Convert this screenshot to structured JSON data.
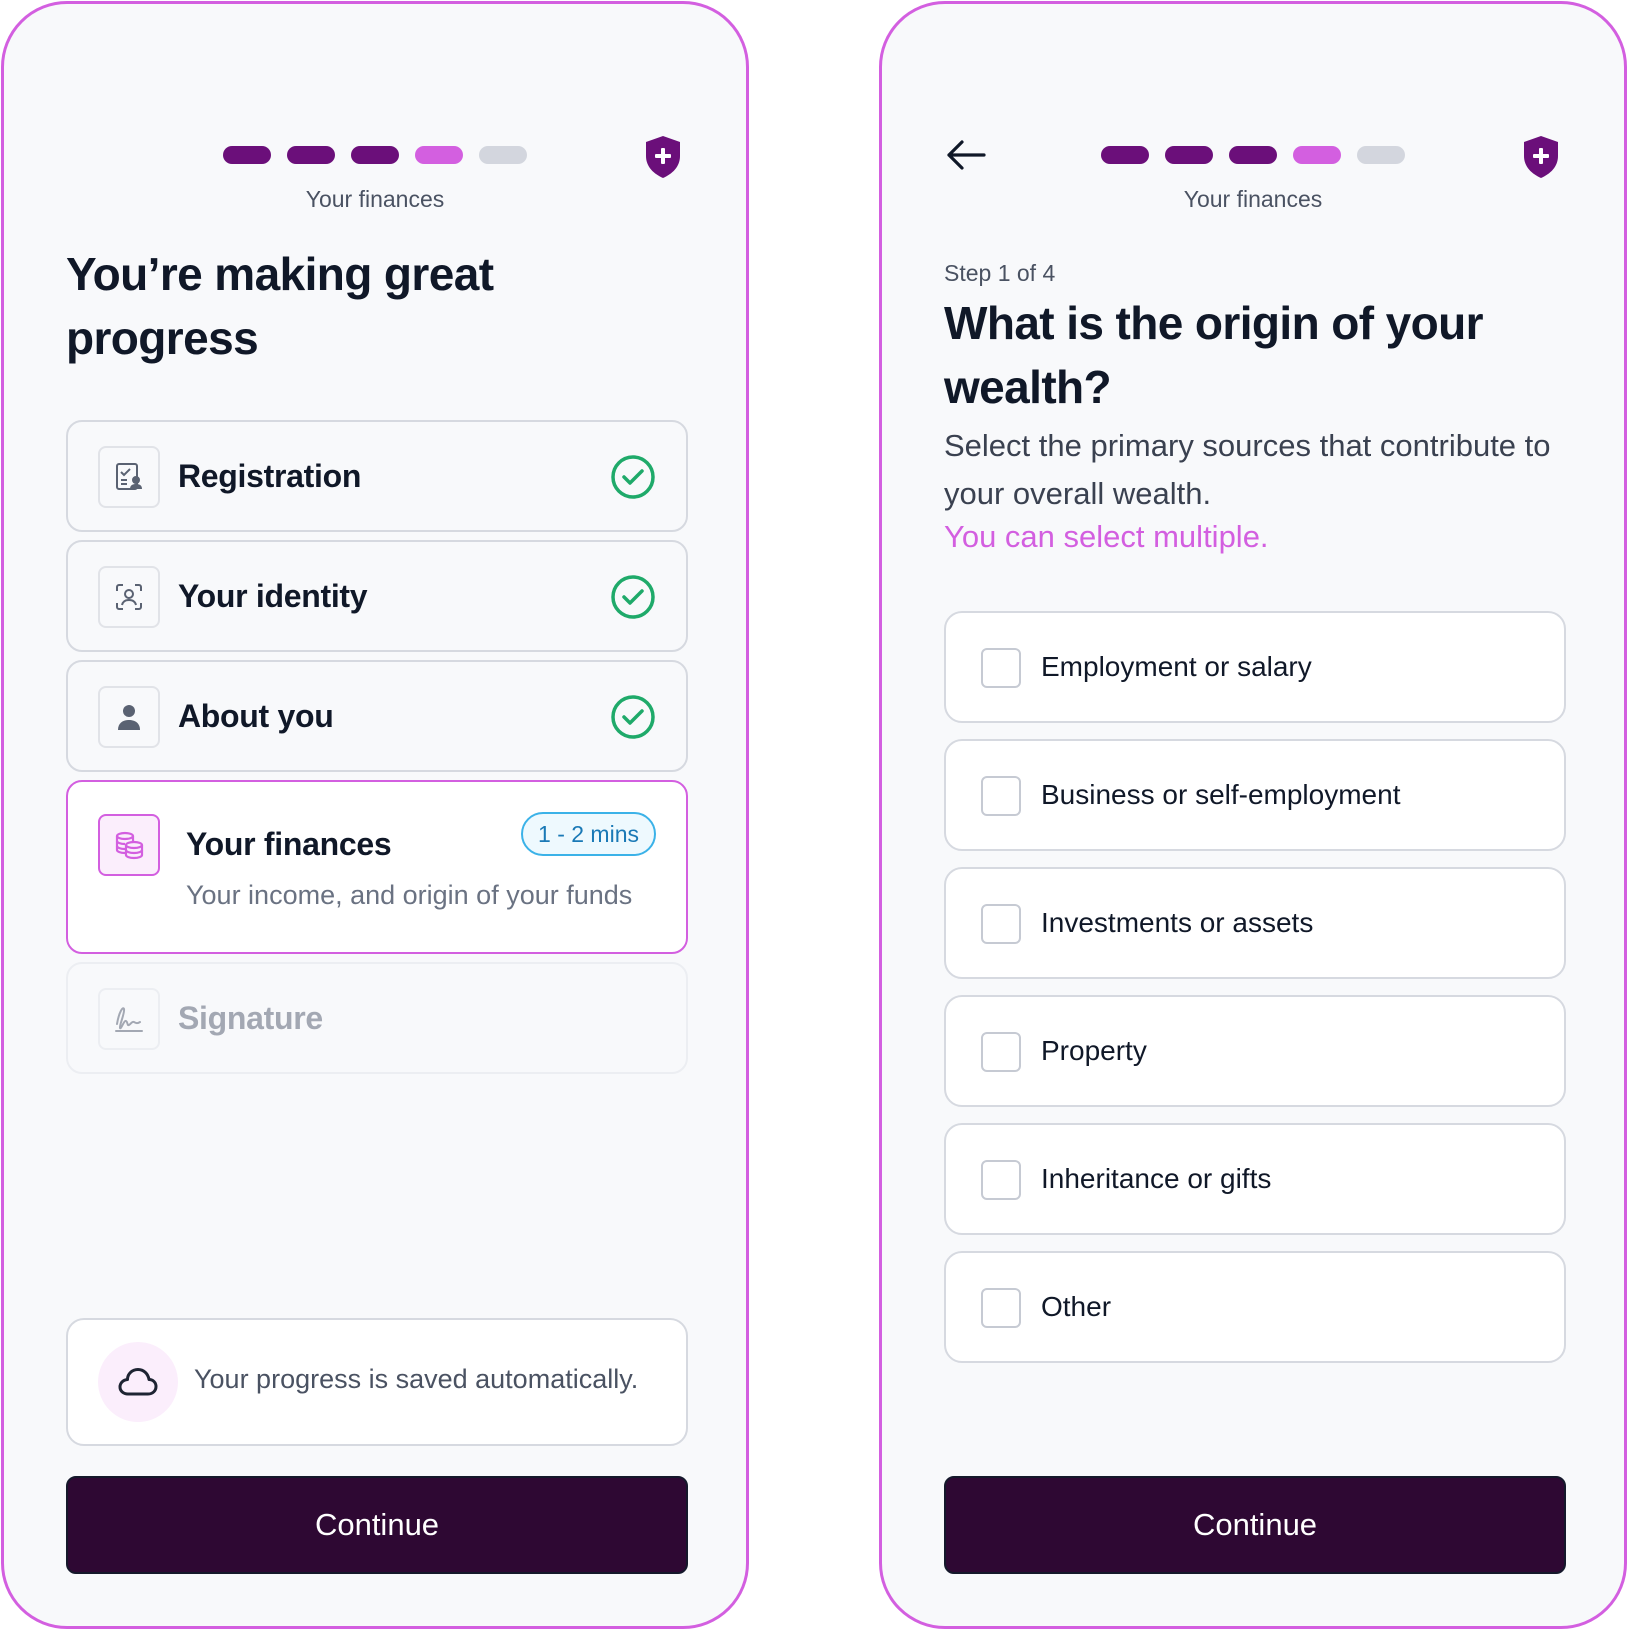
{
  "colors": {
    "accent": "#d35fe0",
    "primary_dark": "#2e0833",
    "step_done": "#6b0f7a",
    "success": "#1faa6a",
    "badge_blue": "#3bb2e8"
  },
  "left": {
    "progress": {
      "total_steps": 5,
      "completed": 3,
      "current": 4
    },
    "section_label": "Your finances",
    "title": "You’re making great progress",
    "tasks": [
      {
        "label": "Registration",
        "icon": "registration-form-icon",
        "status": "complete"
      },
      {
        "label": "Your identity",
        "icon": "face-scan-icon",
        "status": "complete"
      },
      {
        "label": "About you",
        "icon": "person-icon",
        "status": "complete"
      },
      {
        "label": "Your finances",
        "icon": "coins-stack-icon",
        "status": "current",
        "badge": "1 - 2 mins",
        "subtitle": "Your income, and origin of your funds"
      },
      {
        "label": "Signature",
        "icon": "signature-icon",
        "status": "locked"
      }
    ],
    "saved_notice": "Your progress is saved automatically.",
    "continue_label": "Continue"
  },
  "right": {
    "progress": {
      "total_steps": 5,
      "completed": 3,
      "current": 4
    },
    "section_label": "Your finances",
    "step_count": "Step 1 of 4",
    "title": "What is the origin of your wealth?",
    "description": "Select the primary sources that contribute to your overall wealth.",
    "hint": "You can select multiple.",
    "options": [
      {
        "label": "Employment or salary",
        "checked": false
      },
      {
        "label": "Business or self-employment",
        "checked": false
      },
      {
        "label": "Investments or assets",
        "checked": false
      },
      {
        "label": "Property",
        "checked": false
      },
      {
        "label": "Inheritance or gifts",
        "checked": false
      },
      {
        "label": "Other",
        "checked": false
      }
    ],
    "continue_label": "Continue"
  }
}
